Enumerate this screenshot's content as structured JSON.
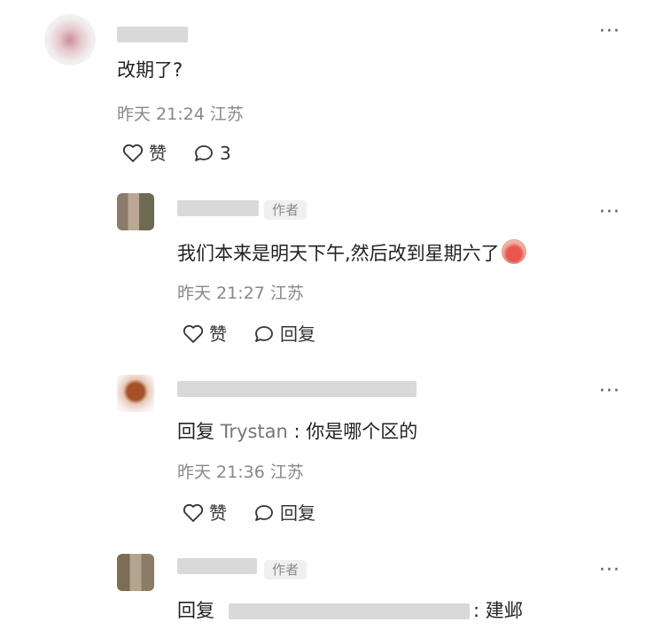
{
  "top_comment": {
    "text": "改期了?",
    "time": "昨天 21:24",
    "location": "江苏",
    "like_label": "赞",
    "reply_count": "3"
  },
  "replies": [
    {
      "author_badge": "作者",
      "text": "我们本来是明天下午,然后改到星期六了",
      "emoji_icon": "crying-face-emoji-icon",
      "time": "昨天 21:27",
      "location": "江苏",
      "like_label": "赞",
      "reply_label": "回复"
    },
    {
      "reply_prefix": "回复",
      "mention": "Trystan",
      "text": " : 你是哪个区的",
      "time": "昨天 21:36",
      "location": "江苏",
      "like_label": "赞",
      "reply_label": "回复"
    },
    {
      "author_badge": "作者",
      "reply_prefix": "回复",
      "text": ": 建邺"
    }
  ],
  "more_label": "···"
}
